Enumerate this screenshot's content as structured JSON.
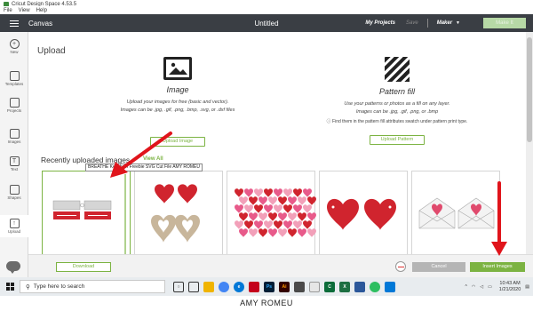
{
  "window": {
    "title": "Cricut Design Space 4.53.5"
  },
  "menu": [
    "File",
    "View",
    "Help"
  ],
  "header": {
    "canvas_label": "Canvas",
    "doc_title": "Untitled",
    "my_projects": "My Projects",
    "save": "Save",
    "machine": "Maker",
    "make_it": "Make It"
  },
  "sidebar": {
    "items": [
      {
        "label": "New",
        "icon": "plus-icon"
      },
      {
        "label": "Templates",
        "icon": "shirt-icon"
      },
      {
        "label": "Projects",
        "icon": "projects-icon"
      },
      {
        "label": "Images",
        "icon": "image-icon"
      },
      {
        "label": "Text",
        "icon": "text-icon"
      },
      {
        "label": "Shapes",
        "icon": "shapes-icon"
      },
      {
        "label": "Upload",
        "icon": "upload-cloud-icon"
      }
    ]
  },
  "upload": {
    "heading": "Upload",
    "image": {
      "title": "Image",
      "desc1": "Upload your images for free (basic and vector).",
      "desc2": "Images can be .jpg, .gif, .png, .bmp, .svg, or .dxf files",
      "button": "Upload Image"
    },
    "pattern": {
      "title": "Pattern fill",
      "desc1": "Use your patterns or photos as a fill on any layer.",
      "desc2": "Images can be .jpg, .gif, .png, or .bmp",
      "hint": "Find them in the pattern fill attributes swatch under pattern print type.",
      "button": "Upload Pattern"
    },
    "recent_label": "Recently uploaded images",
    "view_all": "View All",
    "tooltip": "BREATHE Keychain Freebie SVG Cut File AMY ROMEU"
  },
  "footer": {
    "download": "Download",
    "cancel": "Cancel",
    "insert": "Insert Images"
  },
  "taskbar": {
    "search_placeholder": "Type here to search",
    "time": "10:43 AM",
    "date": "1/21/2020"
  },
  "watermark": "AMY ROMEU",
  "colors": {
    "accent": "#7cb342",
    "header_bg": "#3a3e44",
    "heart_red": "#d0242e",
    "tan": "#c8b69b",
    "arrow_red": "#e0141b"
  }
}
